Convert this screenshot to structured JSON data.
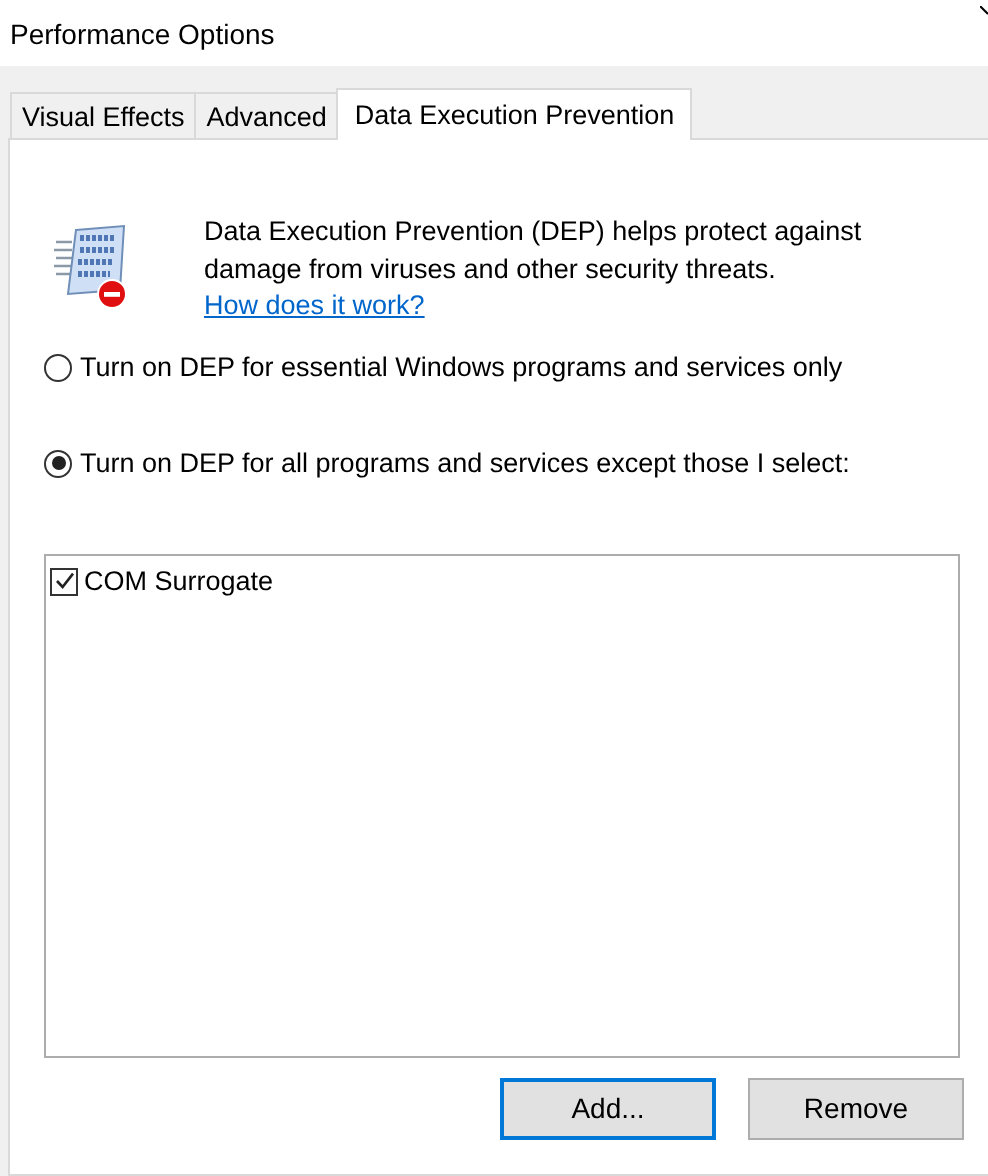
{
  "window": {
    "title": "Performance Options"
  },
  "tabs": [
    {
      "label": "Visual Effects",
      "selected": false
    },
    {
      "label": "Advanced",
      "selected": false
    },
    {
      "label": "Data Execution Prevention",
      "selected": true
    }
  ],
  "description": {
    "text": "Data Execution Prevention (DEP) helps protect against damage from viruses and other security threats.",
    "link": "How does it work?"
  },
  "options": [
    {
      "label": "Turn on DEP for essential Windows programs and services only",
      "selected": false
    },
    {
      "label": "Turn on DEP for all programs and services except those I select:",
      "selected": true
    }
  ],
  "programs": [
    {
      "name": "COM Surrogate",
      "checked": true
    }
  ],
  "buttons": [
    {
      "label": "Add...",
      "kind": "default"
    },
    {
      "label": "Remove",
      "kind": "normal"
    }
  ]
}
